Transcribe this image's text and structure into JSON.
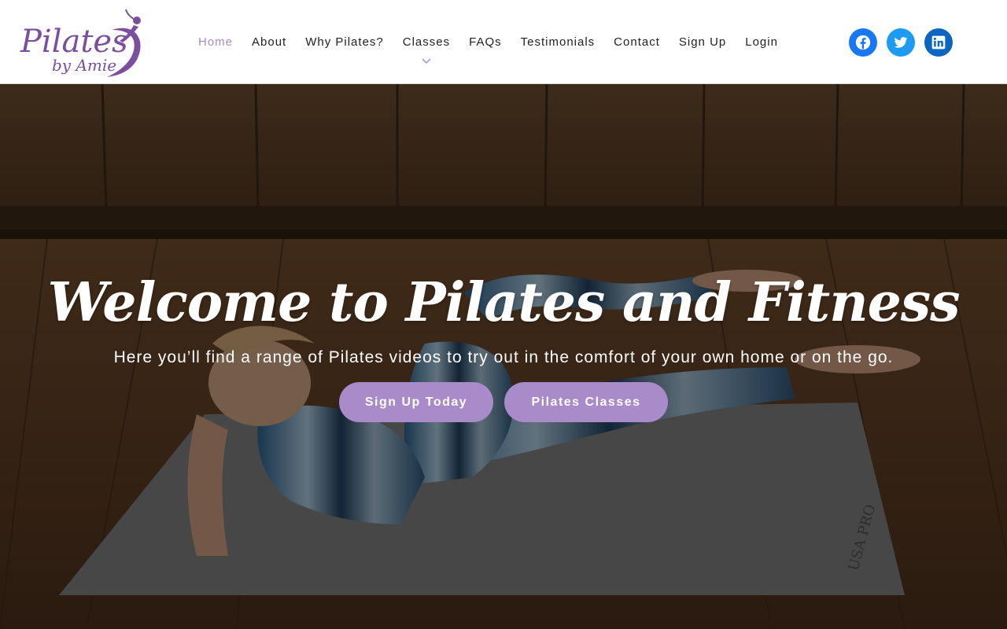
{
  "brand": {
    "logo_text": "Pilates",
    "logo_subtext": "by Amie",
    "logo_color": "#7b4f9e"
  },
  "nav": {
    "items": [
      {
        "label": "Home",
        "active": true
      },
      {
        "label": "About"
      },
      {
        "label": "Why Pilates?"
      },
      {
        "label": "Classes",
        "has_dropdown": true
      },
      {
        "label": "FAQs"
      },
      {
        "label": "Testimonials"
      },
      {
        "label": "Contact"
      },
      {
        "label": "Sign Up"
      },
      {
        "label": "Login"
      }
    ],
    "active_color": "#a98bc9"
  },
  "social": [
    {
      "name": "facebook-icon",
      "color": "#1877f2"
    },
    {
      "name": "twitter-icon",
      "color": "#1d9bf0"
    },
    {
      "name": "linkedin-icon",
      "color": "#0a66c2"
    }
  ],
  "hero": {
    "title": "Welcome to Pilates and Fitness",
    "subtitle": "Here you’ll find a range of Pilates videos to try out in the comfort of your own home or on the go.",
    "buttons": {
      "signup": "Sign Up Today",
      "classes": "Pilates Classes"
    },
    "button_color": "#a98bc9",
    "mat_print": "USA PRO"
  }
}
